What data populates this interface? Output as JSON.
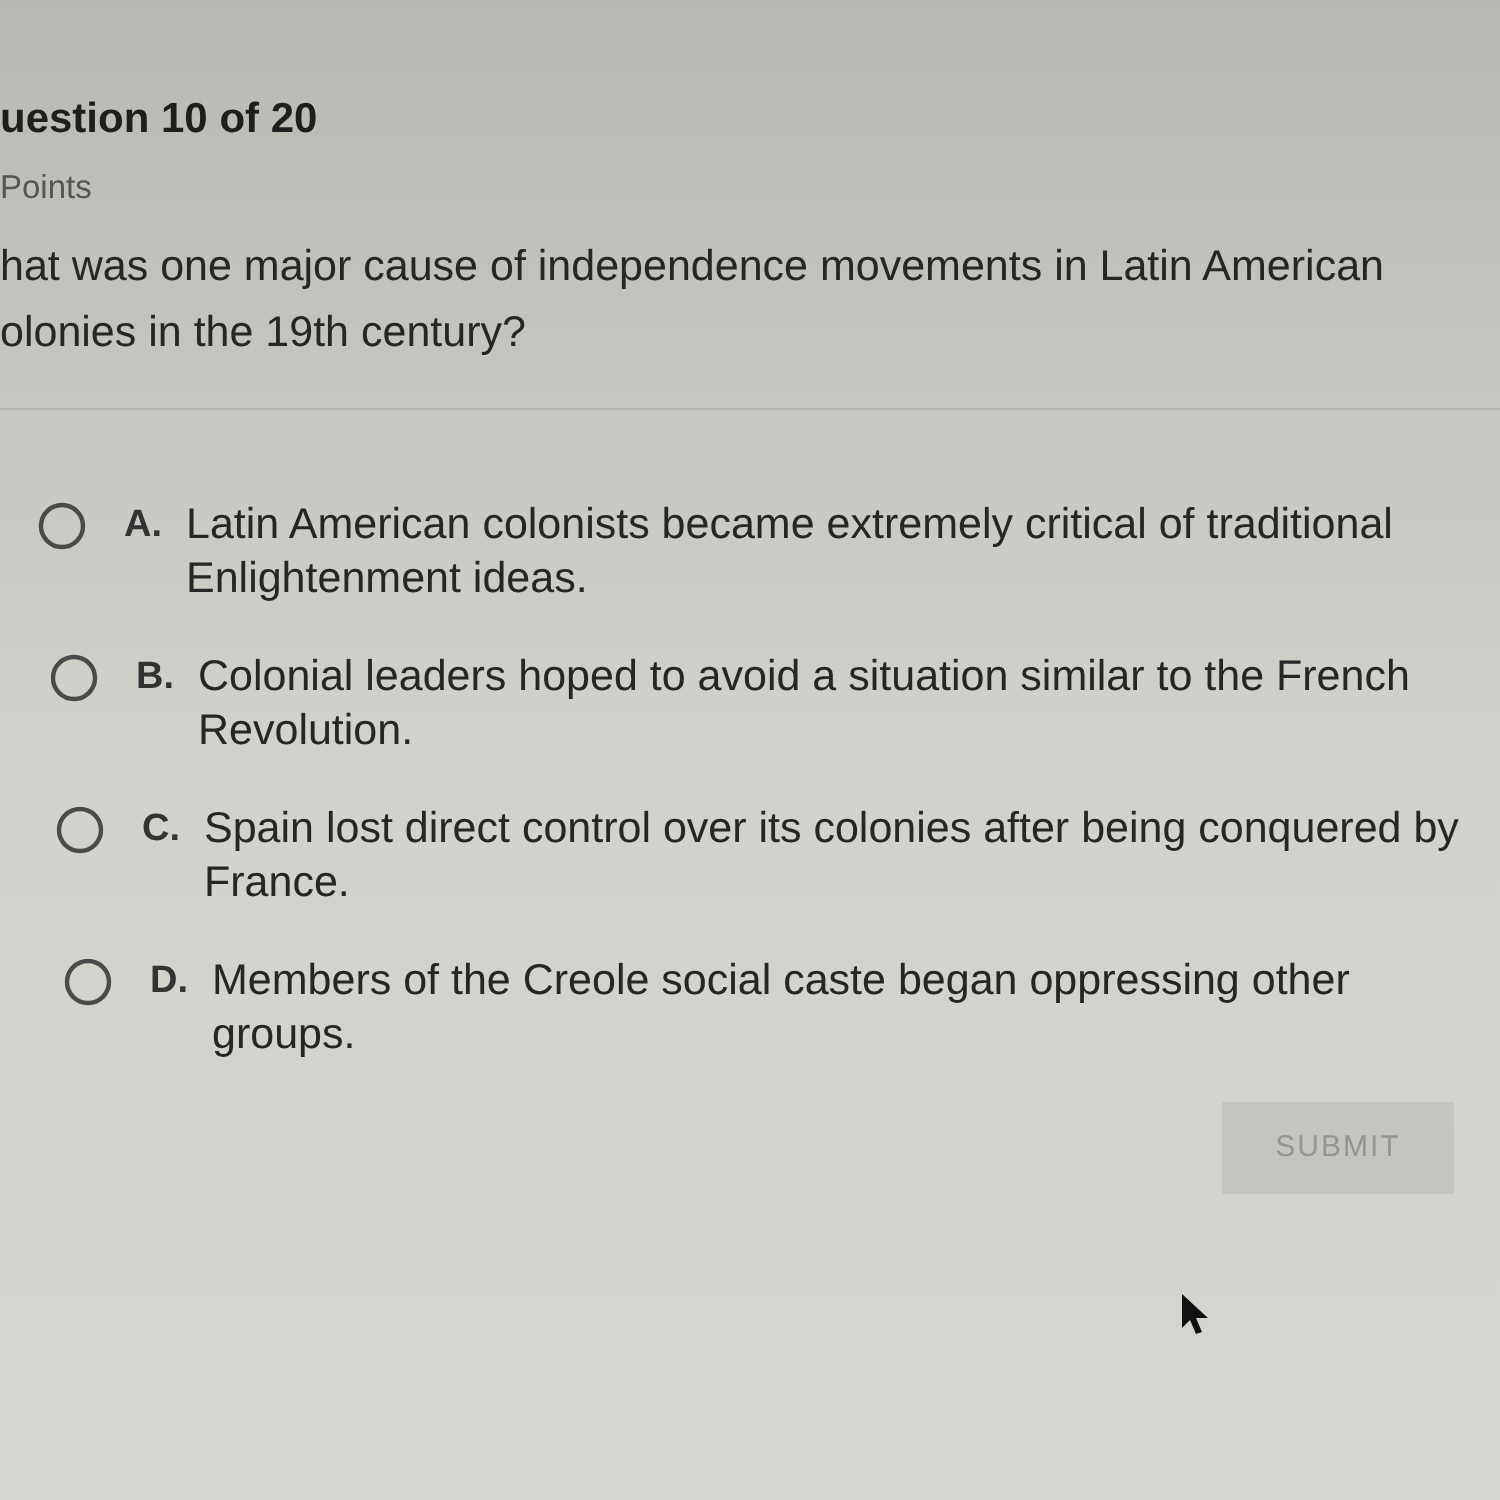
{
  "header": {
    "title": "uestion 10 of 20",
    "points": "Points"
  },
  "question": {
    "lines": [
      "hat was one major cause of independence movements in Latin American",
      "olonies in the 19th century?"
    ]
  },
  "options": [
    {
      "letter": "A.",
      "text": "Latin American colonists became extremely critical of traditional Enlightenment ideas.",
      "selected": false
    },
    {
      "letter": "B.",
      "text": "Colonial leaders hoped to avoid a situation similar to the French Revolution.",
      "selected": false
    },
    {
      "letter": "C.",
      "text": "Spain lost direct control over its colonies after being conquered by France.",
      "selected": false
    },
    {
      "letter": "D.",
      "text": "Members of the Creole social caste began oppressing other groups.",
      "selected": false
    }
  ],
  "submit": {
    "label": "SUBMIT",
    "disabled": true
  }
}
